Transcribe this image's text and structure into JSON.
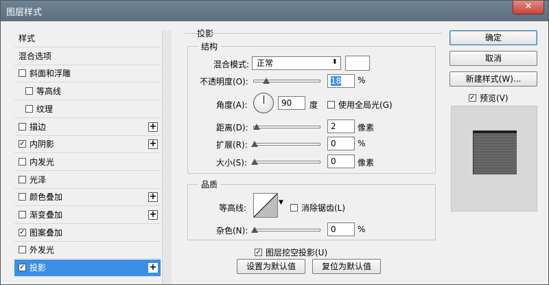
{
  "window": {
    "title": "图层样式",
    "close_glyph": "✕"
  },
  "style_list": {
    "items": [
      {
        "label": "样式",
        "checkbox": false,
        "checked": false,
        "plus": false,
        "sub": false,
        "selected": false
      },
      {
        "label": "混合选项",
        "checkbox": false,
        "checked": false,
        "plus": false,
        "sub": false,
        "selected": false
      },
      {
        "label": "斜面和浮雕",
        "checkbox": true,
        "checked": false,
        "plus": false,
        "sub": false,
        "selected": false
      },
      {
        "label": "等高线",
        "checkbox": true,
        "checked": false,
        "plus": false,
        "sub": true,
        "selected": false
      },
      {
        "label": "纹理",
        "checkbox": true,
        "checked": false,
        "plus": false,
        "sub": true,
        "selected": false
      },
      {
        "label": "描边",
        "checkbox": true,
        "checked": false,
        "plus": true,
        "sub": false,
        "selected": false
      },
      {
        "label": "内阴影",
        "checkbox": true,
        "checked": true,
        "plus": true,
        "sub": false,
        "selected": false
      },
      {
        "label": "内发光",
        "checkbox": true,
        "checked": false,
        "plus": false,
        "sub": false,
        "selected": false
      },
      {
        "label": "光泽",
        "checkbox": true,
        "checked": false,
        "plus": false,
        "sub": false,
        "selected": false
      },
      {
        "label": "颜色叠加",
        "checkbox": true,
        "checked": false,
        "plus": true,
        "sub": false,
        "selected": false
      },
      {
        "label": "渐变叠加",
        "checkbox": true,
        "checked": false,
        "plus": true,
        "sub": false,
        "selected": false
      },
      {
        "label": "图案叠加",
        "checkbox": true,
        "checked": true,
        "plus": false,
        "sub": false,
        "selected": false
      },
      {
        "label": "外发光",
        "checkbox": true,
        "checked": false,
        "plus": false,
        "sub": false,
        "selected": false
      },
      {
        "label": "投影",
        "checkbox": true,
        "checked": true,
        "plus": true,
        "sub": false,
        "selected": true
      }
    ]
  },
  "panel": {
    "section_title": "投影",
    "structure": {
      "title": "结构",
      "blend_mode_label": "混合模式:",
      "blend_mode_value": "正常",
      "opacity_label": "不透明度(O):",
      "opacity_value": "18",
      "opacity_fraction": 0.18,
      "angle_label": "角度(A):",
      "angle_value": "90",
      "angle_unit": "度",
      "global_light_label": "使用全局光(G)",
      "global_light_checked": false,
      "distance_label": "距离(D):",
      "distance_value": "2",
      "distance_unit": "像素",
      "spread_label": "扩展(R):",
      "spread_value": "0",
      "size_label": "大小(S):",
      "size_value": "0",
      "size_unit": "像素",
      "percent": "%"
    },
    "quality": {
      "title": "品质",
      "contour_label": "等高线:",
      "anti_alias_label": "消除锯齿(L)",
      "anti_alias_checked": false,
      "noise_label": "杂色(N):",
      "noise_value": "0",
      "percent": "%"
    },
    "knockout_label": "图层挖空投影(U)",
    "knockout_checked": true,
    "make_default_label": "设置为默认值",
    "reset_default_label": "复位为默认值"
  },
  "buttons": {
    "ok": "确定",
    "cancel": "取消",
    "new_style": "新建样式(W)...",
    "preview_label": "预览(V)",
    "preview_checked": true
  },
  "colors": {
    "selection": "#3b8fe6",
    "titlebar": "#5b6f81",
    "close": "#c5473b"
  }
}
